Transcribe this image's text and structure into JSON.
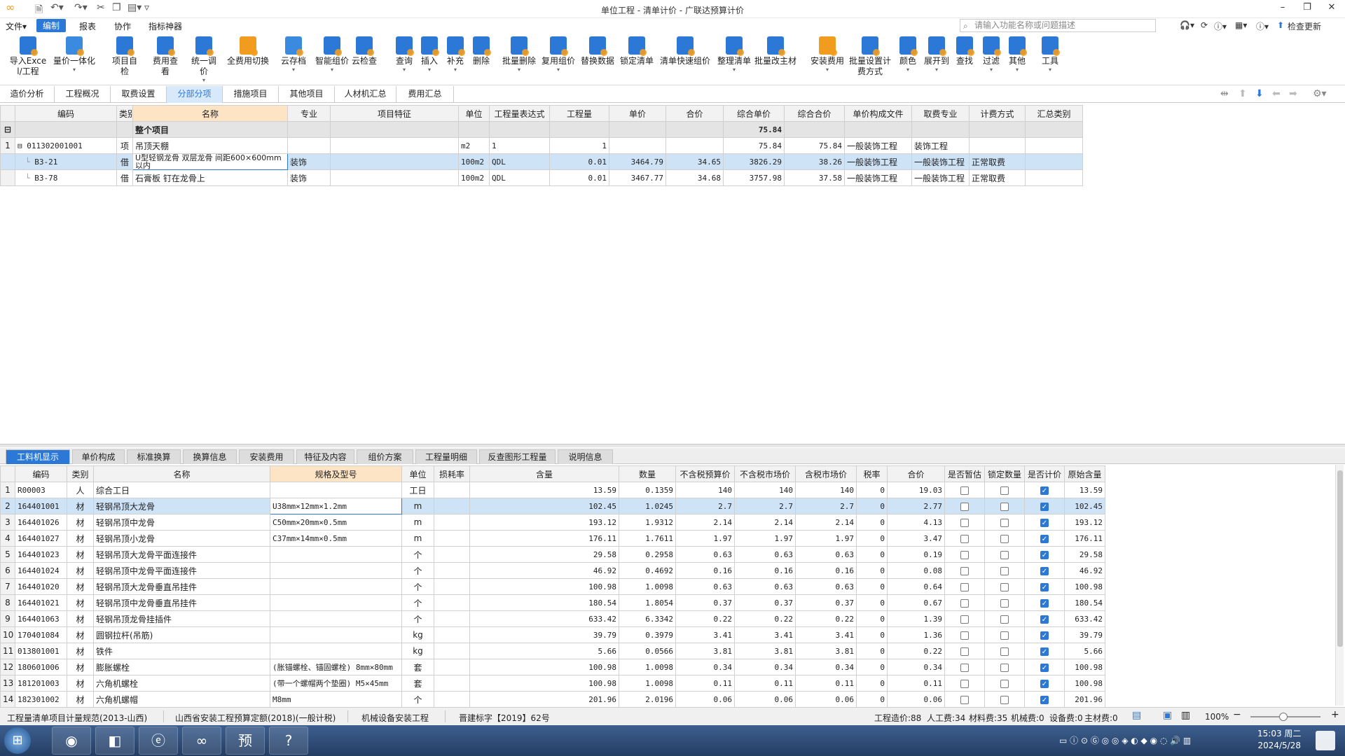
{
  "window": {
    "title": "单位工程 - 清单计价 - 广联达预算计价"
  },
  "menubar": {
    "items": [
      "文件▾",
      "编制",
      "报表",
      "协作",
      "指标神器"
    ],
    "search_placeholder": "请输入功能名称或问题描述",
    "check_update": "检查更新"
  },
  "ribbon": {
    "buttons": [
      {
        "label": "导入Excel/工程",
        "icon": "import-excel-icon"
      },
      {
        "label": "量价一体化",
        "icon": "quantity-price-icon"
      },
      {
        "label": "项目自检",
        "icon": "self-check-icon"
      },
      {
        "label": "费用查看",
        "icon": "cost-view-icon"
      },
      {
        "label": "统一调价",
        "icon": "adjust-price-icon"
      },
      {
        "label": "全费用切换",
        "icon": "full-cost-icon"
      },
      {
        "label": "云存档",
        "icon": "cloud-archive-icon"
      },
      {
        "label": "智能组价",
        "icon": "smart-pricing-icon"
      },
      {
        "label": "云检查",
        "icon": "cloud-check-icon"
      },
      {
        "label": "查询",
        "icon": "query-icon"
      },
      {
        "label": "插入",
        "icon": "insert-icon"
      },
      {
        "label": "补充",
        "icon": "supplement-icon"
      },
      {
        "label": "删除",
        "icon": "delete-icon"
      },
      {
        "label": "批量删除",
        "icon": "batch-delete-icon"
      },
      {
        "label": "复用组价",
        "icon": "reuse-pricing-icon"
      },
      {
        "label": "替换数据",
        "icon": "replace-data-icon"
      },
      {
        "label": "锁定清单",
        "icon": "lock-list-icon"
      },
      {
        "label": "清单快速组价",
        "icon": "quick-pricing-icon"
      },
      {
        "label": "整理清单",
        "icon": "organize-list-icon"
      },
      {
        "label": "批量改主材",
        "icon": "batch-material-icon"
      },
      {
        "label": "安装费用",
        "icon": "install-cost-icon"
      },
      {
        "label": "批量设置计费方式",
        "icon": "batch-billing-icon"
      },
      {
        "label": "颜色",
        "icon": "color-icon"
      },
      {
        "label": "展开到",
        "icon": "expand-icon"
      },
      {
        "label": "查找",
        "icon": "find-icon"
      },
      {
        "label": "过滤",
        "icon": "filter-icon"
      },
      {
        "label": "其他",
        "icon": "other-icon"
      },
      {
        "label": "工具",
        "icon": "tools-icon"
      }
    ]
  },
  "page_tabs": [
    "造价分析",
    "工程概况",
    "取费设置",
    "分部分项",
    "措施项目",
    "其他项目",
    "人材机汇总",
    "费用汇总"
  ],
  "upper_table": {
    "headers": [
      "编码",
      "类别",
      "名称",
      "专业",
      "项目特征",
      "单位",
      "工程量表达式",
      "工程量",
      "单价",
      "合价",
      "综合单价",
      "综合合价",
      "单价构成文件",
      "取费专业",
      "计费方式",
      "汇总类别"
    ],
    "whole_row": {
      "label": "整个项目",
      "total": "75.84"
    },
    "rows": [
      {
        "no": "1",
        "code": "011302001001",
        "type": "项",
        "name": "吊顶天棚",
        "major": "",
        "feature": "",
        "unit": "m2",
        "expr": "1",
        "qty": "1",
        "price": "",
        "sum": "",
        "comp_price": "75.84",
        "comp_sum": "75.84",
        "file": "一般装饰工程",
        "fee": "装饰工程",
        "method": "",
        "cat": ""
      },
      {
        "no": "",
        "code": "B3-21",
        "type": "借",
        "name": "U型轻钢龙骨 双层龙骨 间距600×600mm以内",
        "major": "装饰",
        "feature": "",
        "unit": "100m2",
        "expr": "QDL",
        "qty": "0.01",
        "price": "3464.79",
        "sum": "34.65",
        "comp_price": "3826.29",
        "comp_sum": "38.26",
        "file": "一般装饰工程",
        "fee": "一般装饰工程",
        "method": "正常取费",
        "cat": ""
      },
      {
        "no": "",
        "code": "B3-78",
        "type": "借",
        "name": "石膏板 钉在龙骨上",
        "major": "装饰",
        "feature": "",
        "unit": "100m2",
        "expr": "QDL",
        "qty": "0.01",
        "price": "3467.77",
        "sum": "34.68",
        "comp_price": "3757.98",
        "comp_sum": "37.58",
        "file": "一般装饰工程",
        "fee": "一般装饰工程",
        "method": "正常取费",
        "cat": ""
      }
    ]
  },
  "bottom_tabs": [
    "工料机显示",
    "单价构成",
    "标准换算",
    "换算信息",
    "安装费用",
    "特征及内容",
    "组价方案",
    "工程量明细",
    "反查图形工程量",
    "说明信息"
  ],
  "lower_table": {
    "headers": [
      "编码",
      "类别",
      "名称",
      "规格及型号",
      "单位",
      "损耗率",
      "含量",
      "数量",
      "不含税预算价",
      "不含税市场价",
      "含税市场价",
      "税率",
      "合价",
      "是否暂估",
      "锁定数量",
      "是否计价",
      "原始含量"
    ],
    "rows": [
      {
        "no": "1",
        "code": "R00003",
        "type": "人",
        "name": "综合工日",
        "spec": "",
        "unit": "工日",
        "loss": "",
        "content": "13.59",
        "qty": "0.1359",
        "budget": "140",
        "market": "140",
        "taxmarket": "140",
        "tax": "0",
        "sum": "19.03",
        "est": false,
        "lock": false,
        "priced": true,
        "orig": "13.59"
      },
      {
        "no": "2",
        "code": "164401001",
        "type": "材",
        "name": "轻钢吊顶大龙骨",
        "spec": "U38mm×12mm×1.2mm",
        "unit": "m",
        "loss": "",
        "content": "102.45",
        "qty": "1.0245",
        "budget": "2.7",
        "market": "2.7",
        "taxmarket": "2.7",
        "tax": "0",
        "sum": "2.77",
        "est": false,
        "lock": false,
        "priced": true,
        "orig": "102.45"
      },
      {
        "no": "3",
        "code": "164401026",
        "type": "材",
        "name": "轻钢吊顶中龙骨",
        "spec": "C50mm×20mm×0.5mm",
        "unit": "m",
        "loss": "",
        "content": "193.12",
        "qty": "1.9312",
        "budget": "2.14",
        "market": "2.14",
        "taxmarket": "2.14",
        "tax": "0",
        "sum": "4.13",
        "est": false,
        "lock": false,
        "priced": true,
        "orig": "193.12"
      },
      {
        "no": "4",
        "code": "164401027",
        "type": "材",
        "name": "轻钢吊顶小龙骨",
        "spec": "C37mm×14mm×0.5mm",
        "unit": "m",
        "loss": "",
        "content": "176.11",
        "qty": "1.7611",
        "budget": "1.97",
        "market": "1.97",
        "taxmarket": "1.97",
        "tax": "0",
        "sum": "3.47",
        "est": false,
        "lock": false,
        "priced": true,
        "orig": "176.11"
      },
      {
        "no": "5",
        "code": "164401023",
        "type": "材",
        "name": "轻钢吊顶大龙骨平面连接件",
        "spec": "",
        "unit": "个",
        "loss": "",
        "content": "29.58",
        "qty": "0.2958",
        "budget": "0.63",
        "market": "0.63",
        "taxmarket": "0.63",
        "tax": "0",
        "sum": "0.19",
        "est": false,
        "lock": false,
        "priced": true,
        "orig": "29.58"
      },
      {
        "no": "6",
        "code": "164401024",
        "type": "材",
        "name": "轻钢吊顶中龙骨平面连接件",
        "spec": "",
        "unit": "个",
        "loss": "",
        "content": "46.92",
        "qty": "0.4692",
        "budget": "0.16",
        "market": "0.16",
        "taxmarket": "0.16",
        "tax": "0",
        "sum": "0.08",
        "est": false,
        "lock": false,
        "priced": true,
        "orig": "46.92"
      },
      {
        "no": "7",
        "code": "164401020",
        "type": "材",
        "name": "轻钢吊顶大龙骨垂直吊挂件",
        "spec": "",
        "unit": "个",
        "loss": "",
        "content": "100.98",
        "qty": "1.0098",
        "budget": "0.63",
        "market": "0.63",
        "taxmarket": "0.63",
        "tax": "0",
        "sum": "0.64",
        "est": false,
        "lock": false,
        "priced": true,
        "orig": "100.98"
      },
      {
        "no": "8",
        "code": "164401021",
        "type": "材",
        "name": "轻钢吊顶中龙骨垂直吊挂件",
        "spec": "",
        "unit": "个",
        "loss": "",
        "content": "180.54",
        "qty": "1.8054",
        "budget": "0.37",
        "market": "0.37",
        "taxmarket": "0.37",
        "tax": "0",
        "sum": "0.67",
        "est": false,
        "lock": false,
        "priced": true,
        "orig": "180.54"
      },
      {
        "no": "9",
        "code": "164401063",
        "type": "材",
        "name": "轻钢吊顶龙骨挂插件",
        "spec": "",
        "unit": "个",
        "loss": "",
        "content": "633.42",
        "qty": "6.3342",
        "budget": "0.22",
        "market": "0.22",
        "taxmarket": "0.22",
        "tax": "0",
        "sum": "1.39",
        "est": false,
        "lock": false,
        "priced": true,
        "orig": "633.42"
      },
      {
        "no": "10",
        "code": "170401084",
        "type": "材",
        "name": "圆钢拉杆(吊筋)",
        "spec": "",
        "unit": "kg",
        "loss": "",
        "content": "39.79",
        "qty": "0.3979",
        "budget": "3.41",
        "market": "3.41",
        "taxmarket": "3.41",
        "tax": "0",
        "sum": "1.36",
        "est": false,
        "lock": false,
        "priced": true,
        "orig": "39.79"
      },
      {
        "no": "11",
        "code": "013801001",
        "type": "材",
        "name": "铁件",
        "spec": "",
        "unit": "kg",
        "loss": "",
        "content": "5.66",
        "qty": "0.0566",
        "budget": "3.81",
        "market": "3.81",
        "taxmarket": "3.81",
        "tax": "0",
        "sum": "0.22",
        "est": false,
        "lock": false,
        "priced": true,
        "orig": "5.66"
      },
      {
        "no": "12",
        "code": "180601006",
        "type": "材",
        "name": "膨胀螺栓",
        "spec": "(胀锚螺栓、锚固螺栓) 8mm×80mm",
        "unit": "套",
        "loss": "",
        "content": "100.98",
        "qty": "1.0098",
        "budget": "0.34",
        "market": "0.34",
        "taxmarket": "0.34",
        "tax": "0",
        "sum": "0.34",
        "est": false,
        "lock": false,
        "priced": true,
        "orig": "100.98"
      },
      {
        "no": "13",
        "code": "181201003",
        "type": "材",
        "name": "六角机螺栓",
        "spec": "(带一个螺帽两个垫圈) M5×45mm",
        "unit": "套",
        "loss": "",
        "content": "100.98",
        "qty": "1.0098",
        "budget": "0.11",
        "market": "0.11",
        "taxmarket": "0.11",
        "tax": "0",
        "sum": "0.11",
        "est": false,
        "lock": false,
        "priced": true,
        "orig": "100.98"
      },
      {
        "no": "14",
        "code": "182301002",
        "type": "材",
        "name": "六角机螺帽",
        "spec": "M8mm",
        "unit": "个",
        "loss": "",
        "content": "201.96",
        "qty": "2.0196",
        "budget": "0.06",
        "market": "0.06",
        "taxmarket": "0.06",
        "tax": "0",
        "sum": "0.06",
        "est": false,
        "lock": false,
        "priced": true,
        "orig": "201.96"
      }
    ]
  },
  "statusbar": {
    "left": [
      "工程量清单项目计量规范(2013-山西)",
      "山西省安装工程预算定额(2018)(一般计税)",
      "机械设备安装工程",
      "晋建标字【2019】62号"
    ],
    "right": [
      "工程造价:88",
      "人工费:34",
      "材料费:35",
      "机械费:0",
      "设备费:0",
      "主材费:0"
    ],
    "zoom": "100%"
  },
  "taskbar": {
    "time": "15:03 周二",
    "date": "2024/5/28",
    "apps": [
      "app-browser-icon",
      "app-pin-icon",
      "app-ie-icon",
      "app-glodon-icon",
      "app-budget-icon",
      "app-help-icon"
    ],
    "app_labels": [
      "",
      "",
      "",
      "",
      "预",
      "?"
    ]
  },
  "colors": {
    "accent": "#2b78d6",
    "selected_row": "#cfe3f7",
    "name_header": "#fde4c4"
  }
}
